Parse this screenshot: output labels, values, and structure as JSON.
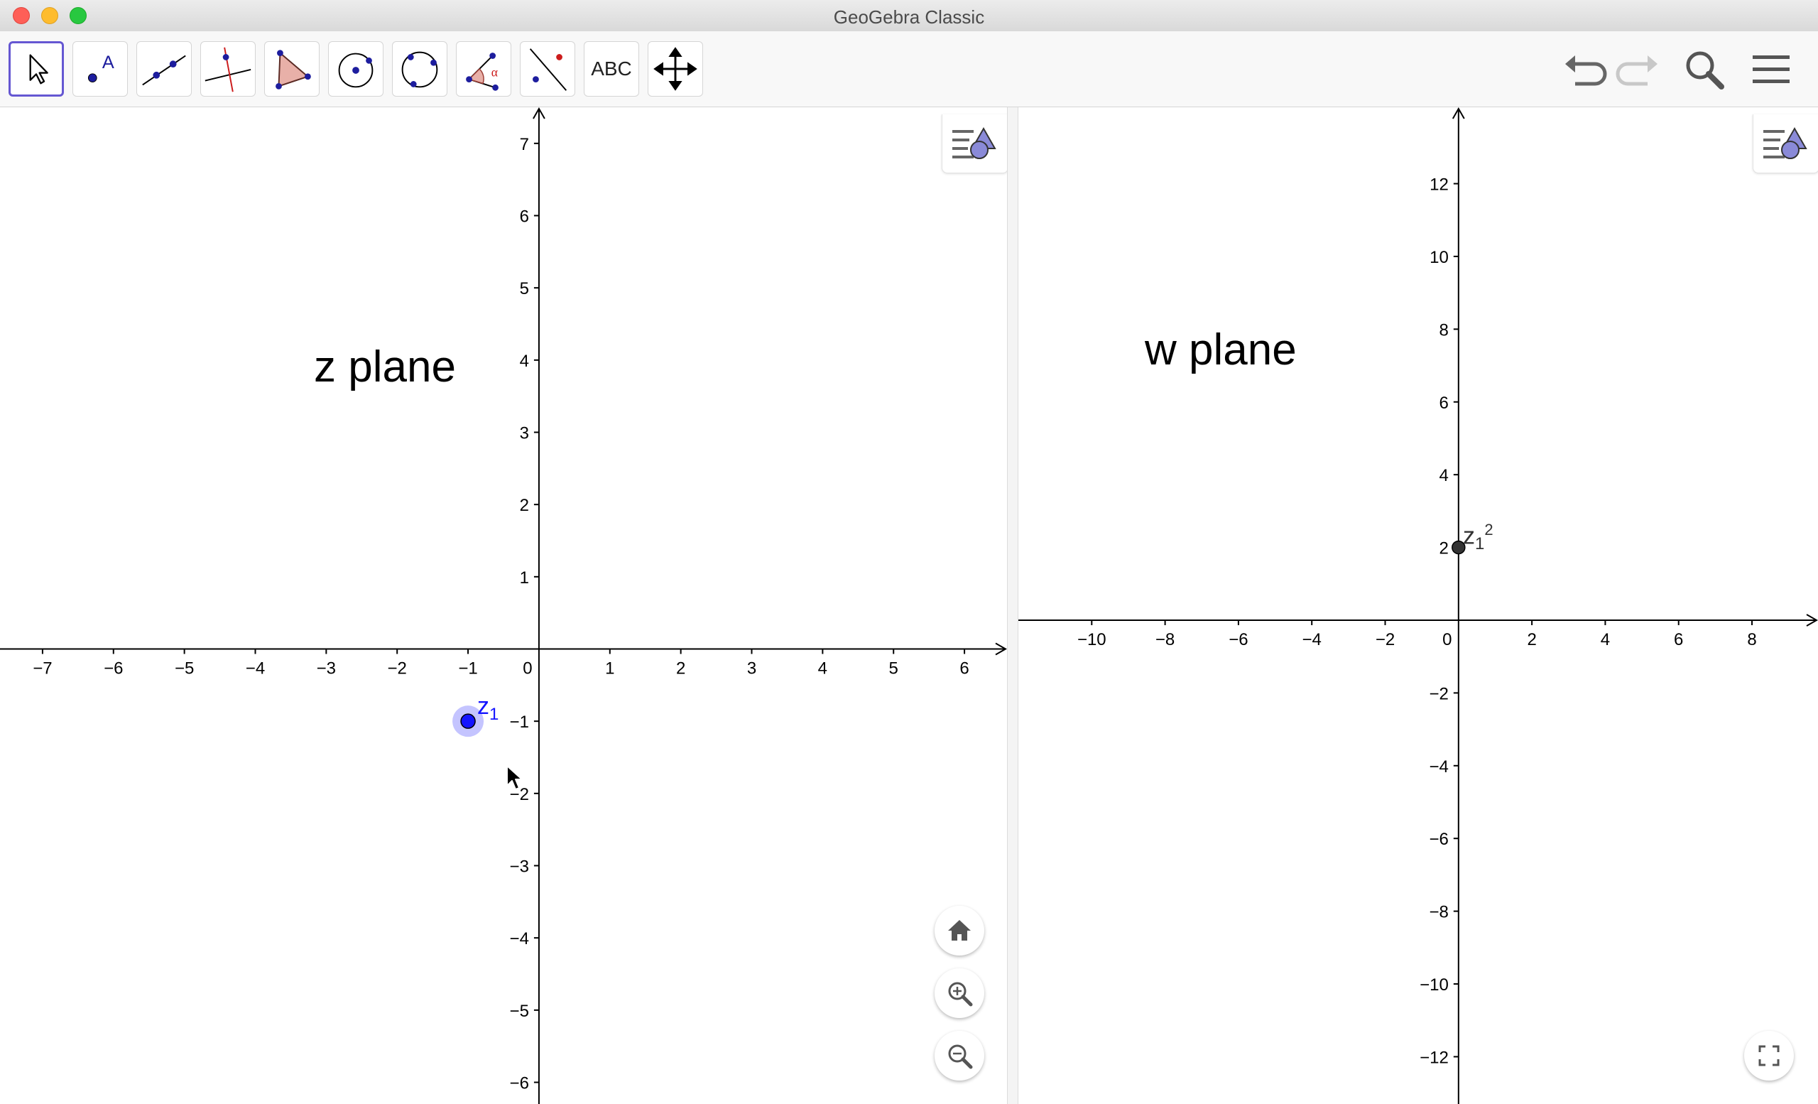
{
  "window": {
    "title": "GeoGebra Classic"
  },
  "toolbar": {
    "tools": [
      {
        "name": "move-tool",
        "selected": true
      },
      {
        "name": "point-tool",
        "glyph": "A"
      },
      {
        "name": "line-tool"
      },
      {
        "name": "perpendicular-line-tool"
      },
      {
        "name": "polygon-tool"
      },
      {
        "name": "circle-center-point-tool"
      },
      {
        "name": "circle-three-points-tool"
      },
      {
        "name": "angle-tool",
        "glyph": "α"
      },
      {
        "name": "reflect-tool"
      },
      {
        "name": "text-tool",
        "label": "ABC"
      },
      {
        "name": "move-graphics-view-tool"
      }
    ],
    "right_icons": [
      "undo-icon",
      "redo-icon",
      "search-icon",
      "menu-icon"
    ]
  },
  "view1": {
    "label": "z plane",
    "x_range": [
      -7.6,
      6.6
    ],
    "y_range": [
      -6.3,
      7.5
    ],
    "x_ticks": [
      -7,
      -6,
      -5,
      -4,
      -3,
      -2,
      -1,
      0,
      1,
      2,
      3,
      4,
      5,
      6
    ],
    "y_ticks": [
      -6,
      -5,
      -4,
      -3,
      -2,
      -1,
      1,
      2,
      3,
      4,
      5,
      6,
      7
    ],
    "point": {
      "name": "z",
      "subscript": "1",
      "x": -1,
      "y": -1,
      "color": "#1414ff"
    }
  },
  "view2": {
    "label": "w plane",
    "x_range": [
      -12,
      9.8
    ],
    "y_range": [
      -13.3,
      14.1
    ],
    "x_ticks": [
      -10,
      -8,
      -6,
      -4,
      -2,
      0,
      2,
      4,
      6,
      8
    ],
    "y_ticks": [
      -12,
      -10,
      -8,
      -6,
      -4,
      -2,
      2,
      4,
      6,
      8,
      10,
      12
    ],
    "point": {
      "name": "z",
      "subscript": "1",
      "superscript": "2",
      "x": 0,
      "y": 2,
      "color": "#333333"
    }
  },
  "view_controls": [
    "home-icon",
    "zoom-in-icon",
    "zoom-out-icon",
    "fullscreen-icon"
  ]
}
